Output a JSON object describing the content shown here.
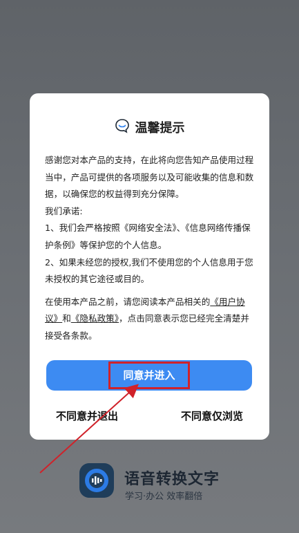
{
  "dialog": {
    "title": "温馨提示",
    "paragraphs": [
      "感谢您对本产品的支持，在此将向您告知产品使用过程当中，产品可提供的各项服务以及可能收集的信息和数据，以确保您的权益得到充分保障。",
      "我们承诺:",
      "1、我们会严格按照《网络安全法》、《信息网络传播保护条例》等保护您的个人信息。",
      "2、如果未经您的授权,我们不使用您的个人信息用于您未授权的其它途径或目的。"
    ],
    "notice": {
      "prefix": "在使用本产品之前，请您阅读本产品相关的",
      "link_user_agreement": "《用户协议》",
      "and": "和",
      "link_privacy_policy": "《隐私政策》",
      "suffix": "，点击同意表示您已经完全清楚并接受各条款。"
    },
    "agree_button": "同意并进入",
    "disagree_exit": "不同意并退出",
    "disagree_browse": "不同意仅浏览"
  },
  "background": {
    "app_name": "语音转换文字",
    "slogan": "学习·办公 效率翻倍"
  },
  "colors": {
    "primary": "#3d8bf2",
    "highlight": "#d0222a"
  }
}
